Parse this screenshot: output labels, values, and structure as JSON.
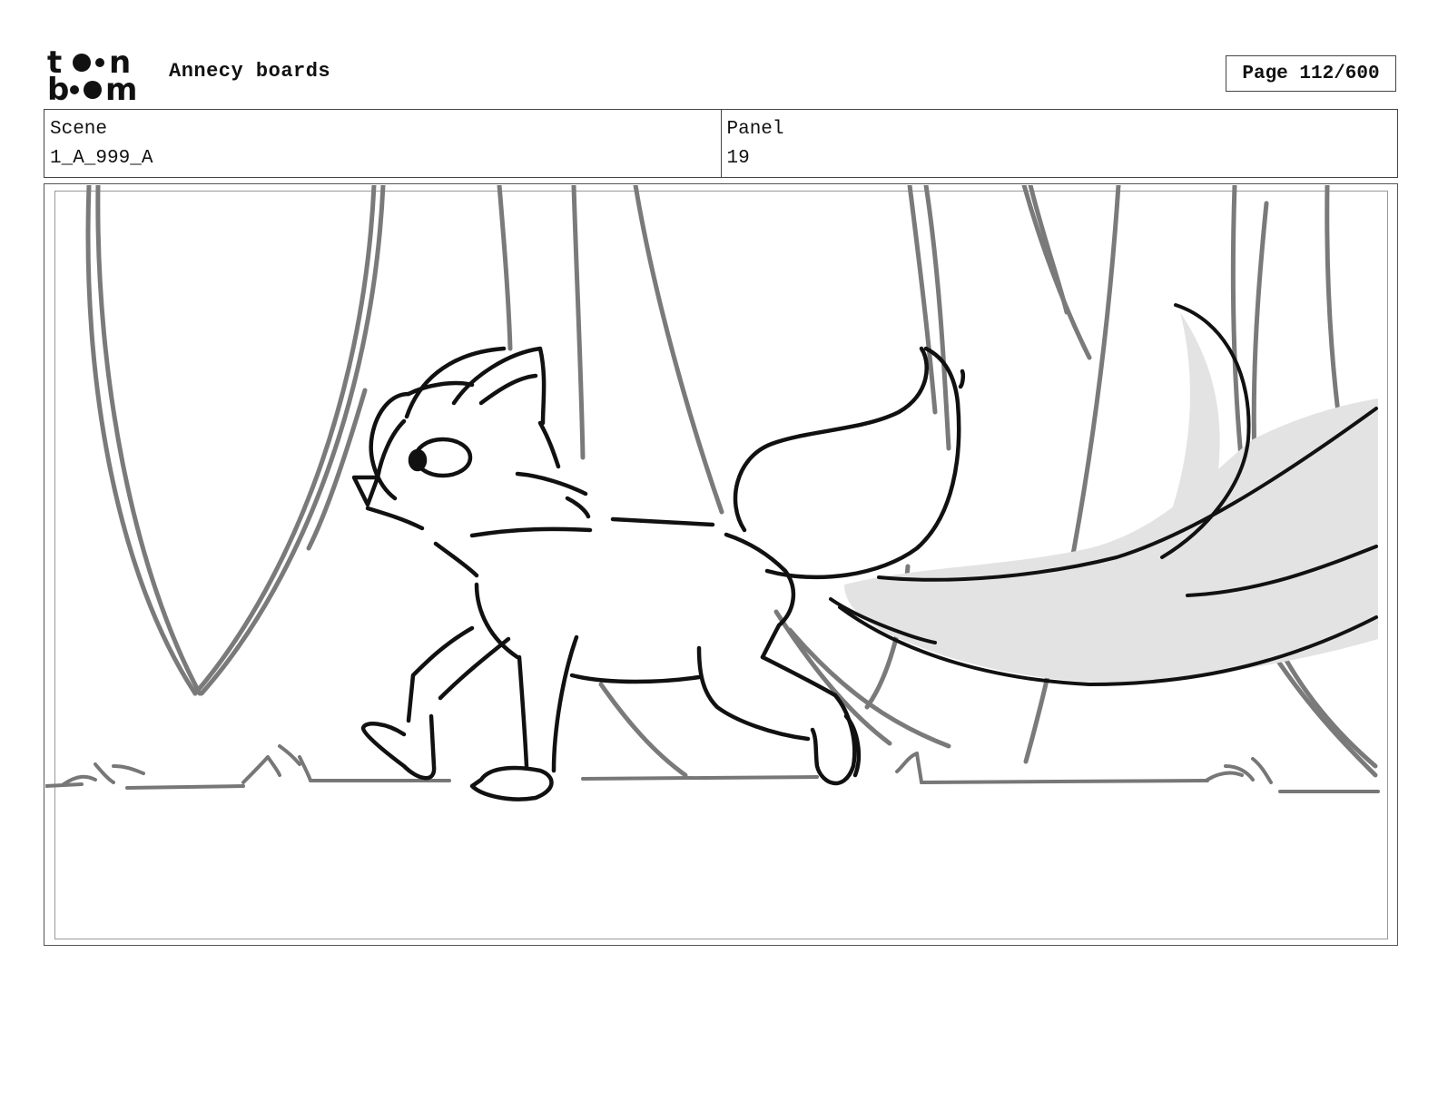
{
  "header": {
    "logo_text": "toon boom",
    "project_title": "Annecy boards",
    "page_label": "Page 112/600"
  },
  "info": {
    "scene_label": "Scene",
    "scene_value": "1_A_999_A",
    "panel_label": "Panel",
    "panel_value": "19"
  },
  "panel_image": {
    "icon": "sketch-fox-walking-forest"
  }
}
